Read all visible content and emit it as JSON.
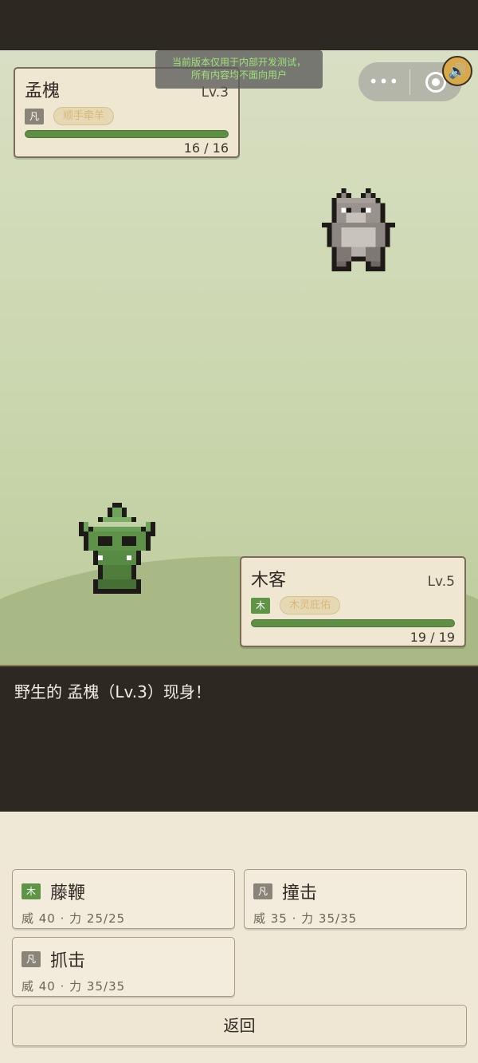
{
  "dev_notice": {
    "line1": "当前版本仅用于内部开发测试，",
    "line2": "所有内容均不面向用户"
  },
  "capsule": {
    "more_icon": "more-dots-icon",
    "close_icon": "target-circle-icon"
  },
  "sound_icon": "speaker-icon",
  "enemy": {
    "name": "孟槐",
    "level": "Lv.3",
    "type_tag": "凡",
    "trait": "顺手牵羊",
    "hp_text": "16 / 16",
    "hp_ratio": 1.0
  },
  "player": {
    "name": "木客",
    "level": "Lv.5",
    "type_tag": "木",
    "trait": "木灵庇佑",
    "hp_text": "19 / 19",
    "hp_ratio": 1.0
  },
  "battle_log": "野生的 孟槐（Lv.3）现身！",
  "moves": [
    {
      "type_tag": "木",
      "name": "藤鞭",
      "stats": "威 40 · 力 25/25"
    },
    {
      "type_tag": "凡",
      "name": "撞击",
      "stats": "威 35 · 力 35/35"
    },
    {
      "type_tag": "凡",
      "name": "抓击",
      "stats": "威 40 · 力 35/35"
    }
  ],
  "back_label": "返回",
  "colors": {
    "hp_green": "#5e8f45",
    "wood_tag": "#5f9447",
    "common_tag": "#8a8378",
    "log_bg": "#2e2822"
  }
}
